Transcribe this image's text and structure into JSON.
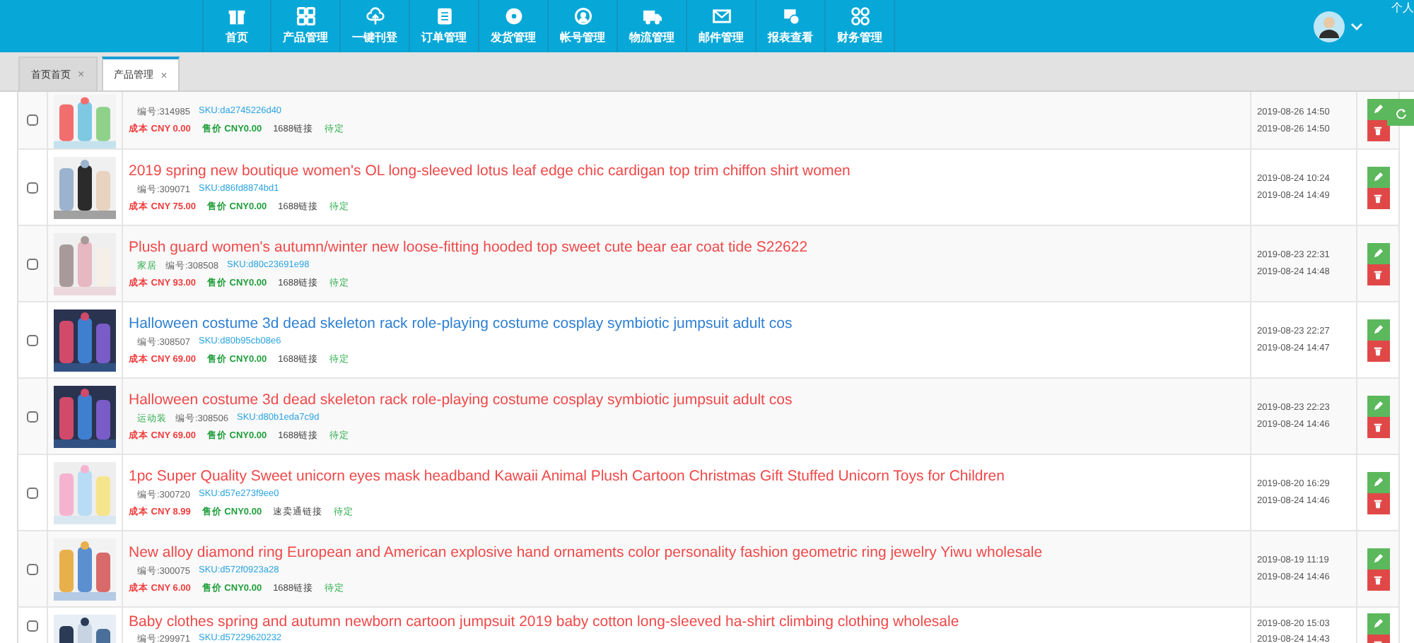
{
  "nav": {
    "items": [
      {
        "label": "首页"
      },
      {
        "label": "产品管理"
      },
      {
        "label": "一键刊登"
      },
      {
        "label": "订单管理"
      },
      {
        "label": "发货管理"
      },
      {
        "label": "帐号管理"
      },
      {
        "label": "物流管理"
      },
      {
        "label": "邮件管理"
      },
      {
        "label": "报表查看"
      },
      {
        "label": "财务管理"
      }
    ],
    "user_menu": "个人"
  },
  "tabs": [
    {
      "label": "首页首页",
      "close": "×",
      "selected": false
    },
    {
      "label": "产品管理",
      "close": "×",
      "selected": true
    }
  ],
  "products": [
    {
      "checked": false,
      "code": "编号:314985",
      "sku": "SKU:da2745226d40",
      "cost": "成本 CNY 0.00",
      "price": "售价 CNY0.00",
      "link": "1688链接",
      "status": "待定",
      "created": "2019-08-26 14:50",
      "updated": "2019-08-26 14:50"
    },
    {
      "checked": false,
      "title": "2019 spring new boutique women's OL long-sleeved lotus leaf edge chic cardigan top trim chiffon shirt women",
      "color": "#f04848",
      "code": "编号:309071",
      "sku": "SKU:d86fd8874bd1",
      "cost": "成本 CNY 75.00",
      "price": "售价 CNY0.00",
      "link": "1688链接",
      "status": "待定",
      "created": "2019-08-24 10:24",
      "updated": "2019-08-24 14:49"
    },
    {
      "checked": false,
      "title": "Plush guard women's autumn/winter new loose-fitting hooded top sweet cute bear ear coat tide S22622",
      "color": "#f04848",
      "tag": "家居",
      "code": "编号:308508",
      "sku": "SKU:d80c23691e98",
      "cost": "成本 CNY 93.00",
      "price": "售价 CNY0.00",
      "link": "1688链接",
      "status": "待定",
      "created": "2019-08-23 22:31",
      "updated": "2019-08-24 14:48"
    },
    {
      "checked": false,
      "title": "Halloween costume 3d dead skeleton rack role-playing costume cosplay symbiotic jumpsuit adult cos",
      "color": "#2d7fd2",
      "code": "编号:308507",
      "sku": "SKU:d80b95cb08e6",
      "cost": "成本 CNY 69.00",
      "price": "售价 CNY0.00",
      "link": "1688链接",
      "status": "待定",
      "created": "2019-08-23 22:27",
      "updated": "2019-08-24 14:47"
    },
    {
      "checked": false,
      "title": "Halloween costume 3d dead skeleton rack role-playing costume cosplay symbiotic jumpsuit adult cos",
      "color": "#f04848",
      "tag": "运动装",
      "code": "编号:308506",
      "sku": "SKU:d80b1eda7c9d",
      "cost": "成本 CNY 69.00",
      "price": "售价 CNY0.00",
      "link": "1688链接",
      "status": "待定",
      "created": "2019-08-23 22:23",
      "updated": "2019-08-24 14:46"
    },
    {
      "checked": false,
      "title": "1pc Super Quality Sweet unicorn eyes mask headband Kawaii Animal Plush Cartoon Christmas Gift Stuffed Unicorn Toys for Children",
      "color": "#f04848",
      "code": "编号:300720",
      "sku": "SKU:d57e273f9ee0",
      "cost": "成本 CNY 8.99",
      "price": "售价 CNY0.00",
      "link": "速卖通链接",
      "status": "待定",
      "created": "2019-08-20 16:29",
      "updated": "2019-08-24 14:46"
    },
    {
      "checked": false,
      "title": "New alloy diamond ring European and American explosive hand ornaments color personality fashion geometric ring jewelry Yiwu wholesale",
      "color": "#f04848",
      "code": "编号:300075",
      "sku": "SKU:d572f0923a28",
      "cost": "成本 CNY 6.00",
      "price": "售价 CNY0.00",
      "link": "1688链接",
      "status": "待定",
      "created": "2019-08-19 11:19",
      "updated": "2019-08-24 14:46"
    },
    {
      "checked": false,
      "title": "Baby clothes spring and autumn newborn cartoon jumpsuit 2019 baby cotton long-sleeved ha-shirt climbing clothing wholesale",
      "color": "#f04848",
      "code": "编号:299971",
      "sku": "SKU:d57229620232",
      "created": "2019-08-20 15:03",
      "updated": "2019-08-24 14:43"
    }
  ]
}
